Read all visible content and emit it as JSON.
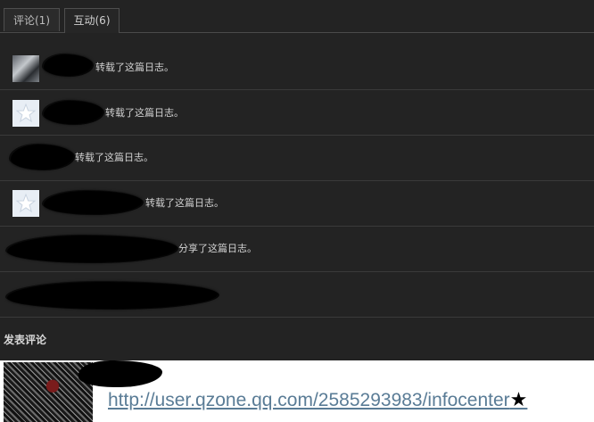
{
  "tabs": [
    {
      "label": "评论(1)",
      "active": false
    },
    {
      "label": "互动(6)",
      "active": true
    }
  ],
  "activities": [
    {
      "avatar": "photo",
      "action": "转载了这篇日志。"
    },
    {
      "avatar": "default-star",
      "action": "转载了这篇日志。"
    },
    {
      "avatar": "none",
      "action": "转载了这篇日志。"
    },
    {
      "avatar": "default-star",
      "action": "转载了这篇日志。"
    },
    {
      "avatar": "none",
      "action": "分享了这篇日志。"
    },
    {
      "avatar": "none",
      "action": ""
    }
  ],
  "comment": {
    "title": "发表评论",
    "link_text": "http://user.qzone.qq.com/2585293983/infocenter",
    "link_suffix": "★"
  },
  "colors": {
    "background": "#232323",
    "text": "#d2d2d2",
    "link": "#5a7c96",
    "divider": "#3a3a3a"
  }
}
